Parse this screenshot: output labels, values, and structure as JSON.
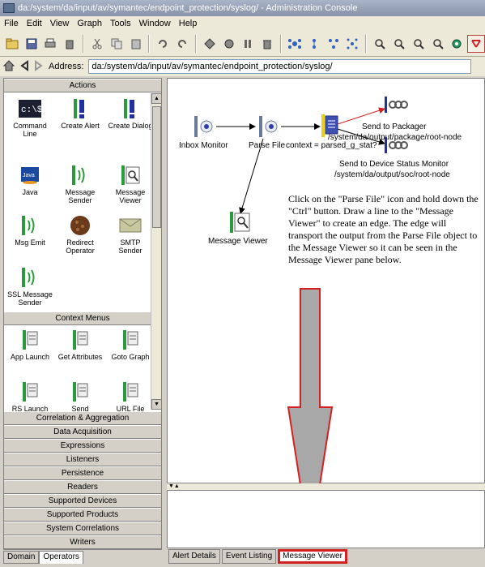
{
  "window": {
    "title": "da:/system/da/input/av/symantec/endpoint_protection/syslog/ - Administration Console"
  },
  "menu": [
    "File",
    "Edit",
    "View",
    "Graph",
    "Tools",
    "Window",
    "Help"
  ],
  "address": {
    "label": "Address:",
    "value": "da:/system/da/input/av/symantec/endpoint_protection/syslog/"
  },
  "left_panel": {
    "actions_header": "Actions",
    "actions": [
      {
        "label": "Command Line",
        "icon": "command-line-icon"
      },
      {
        "label": "Create Alert",
        "icon": "create-alert-icon"
      },
      {
        "label": "Create Dialog",
        "icon": "create-dialog-icon"
      },
      {
        "label": "Java",
        "icon": "java-icon"
      },
      {
        "label": "Message Sender",
        "icon": "message-sender-icon"
      },
      {
        "label": "Message Viewer",
        "icon": "message-viewer-icon"
      },
      {
        "label": "Msg Emit",
        "icon": "msg-emit-icon"
      },
      {
        "label": "Redirect Operator",
        "icon": "redirect-operator-icon"
      },
      {
        "label": "SMTP Sender",
        "icon": "smtp-sender-icon"
      },
      {
        "label": "SSL Message Sender",
        "icon": "ssl-message-sender-icon"
      }
    ],
    "context_header": "Context Menus",
    "context_items": [
      {
        "label": "App Launch"
      },
      {
        "label": "Get Attributes"
      },
      {
        "label": "Goto Graph"
      },
      {
        "label": "RS Launch"
      },
      {
        "label": "Send"
      },
      {
        "label": "URL File"
      }
    ],
    "categories": [
      "Correlation & Aggregation",
      "Data Acquisition",
      "Expressions",
      "Listeners",
      "Persistence",
      "Readers",
      "Supported Devices",
      "Supported Products",
      "System Correlations",
      "Writers"
    ],
    "tabs": [
      "Domain",
      "Operators"
    ]
  },
  "canvas": {
    "nodes": {
      "inbox_monitor": "Inbox Monitor",
      "parse_file": "Parse File",
      "send_packager": "Send to Packager",
      "packager_path": "/system/da/output/package/root-node",
      "context_label": "context = parsed_g_stat?",
      "send_device": "Send to Device Status Monitor",
      "device_path": "/system/da/output/soc/root-node",
      "message_viewer": "Message Viewer"
    },
    "instructions": "Click on the \"Parse File\" icon and hold down the \"Ctrl\" button. Draw a line to the \"Message Viewer\" to create an edge. The edge will transport the output from the Parse File object to the Message Viewer so it can be seen in the Message Viewer pane below."
  },
  "bottom_tabs": [
    "Alert Details",
    "Event Listing",
    "Message Viewer"
  ],
  "colors": {
    "highlight": "#d42020",
    "arrow_fill": "#a8a8a8"
  }
}
